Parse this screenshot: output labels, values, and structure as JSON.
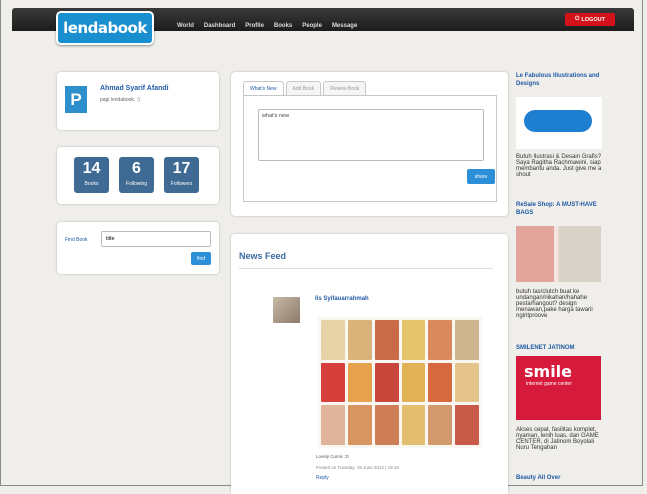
{
  "header": {
    "logo_text": "lendabook",
    "nav": [
      "World",
      "Dashboard",
      "Profile",
      "Books",
      "People",
      "Message"
    ],
    "logout_label": "LOGOUT"
  },
  "profile": {
    "name": "Ahmad Syarif Afandi",
    "subtitle": "pagi lendabook. :)",
    "avatar_letter": "P"
  },
  "stats": [
    {
      "value": "14",
      "label": "Books"
    },
    {
      "value": "6",
      "label": "Following"
    },
    {
      "value": "17",
      "label": "Followers"
    }
  ],
  "find": {
    "label": "Find Book",
    "value": "title",
    "button": "find"
  },
  "post": {
    "tabs": [
      "What's New",
      "Add Book",
      "Review Book"
    ],
    "textarea_value": "what's new",
    "share_label": "share"
  },
  "feed": {
    "title": "News Feed",
    "item": {
      "author": "Iis Syifauarrahmah",
      "caption": "Lovely Comic :D",
      "posted": "Posted on Tuesday, 19 June 2012 | 19:16",
      "reply": "Reply"
    }
  },
  "sidebar": {
    "ads": [
      {
        "title": "Le Fabulous Illustrations and Designs",
        "text": "Butuh Ilustrasi & Desain Grafis? Saya Ragitha Rachmawini, siap membantu anda. Just give me a shout"
      },
      {
        "title": "ReSale Shop: A MUST-HAVE BAGS",
        "text": "butuh tas/clutch buat ke undangan/nikahan/hahahe pesta/hangout? design menawan,pake harga tawarii ngiritproove"
      },
      {
        "title": "SMILENET JATINOM",
        "text": "Akses cepat, fasilitas komplet, nyaman, lenih luas, dan GAME CENTER, di Jatinom Boyolali Nuru Tengahan",
        "img_text": "smile",
        "img_subtext": "internet game center"
      },
      {
        "title": "Beauty All Over"
      }
    ]
  },
  "colors": {
    "accent": "#1f5aa6",
    "button": "#2c8fd8",
    "stat_tile": "#3e6a94",
    "logout": "#d3121c",
    "topbar": "#2a2a2a"
  }
}
